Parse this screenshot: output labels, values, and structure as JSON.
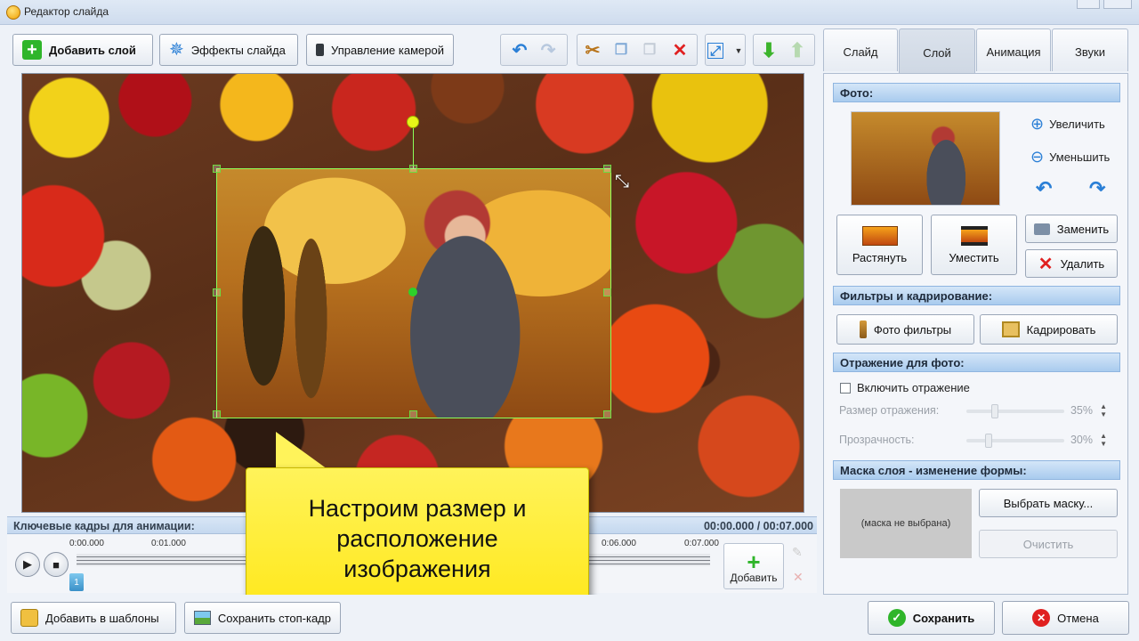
{
  "window": {
    "title": "Редактор слайда"
  },
  "toolbar": {
    "add_layer": "Добавить слой",
    "slide_effects": "Эффекты слайда",
    "camera": "Управление камерой",
    "icons": [
      "undo-icon",
      "redo-icon",
      "cut-icon",
      "copy-icon",
      "paste-icon",
      "delete-icon",
      "fit-view-icon",
      "move-down-icon",
      "move-up-icon"
    ]
  },
  "callout": {
    "text": "Настроим размер и\nрасположение\nизображения"
  },
  "keyframes": {
    "label": "Ключевые кадры для анимации:",
    "time": "00:00.000 / 00:07.000",
    "ticks": [
      "0:00.000",
      "0:01.000",
      "0:06.000",
      "0:07.000"
    ],
    "marker": "1",
    "add_label": "Добавить"
  },
  "tabs": [
    {
      "label": "Слайд",
      "active": false
    },
    {
      "label": "Слой",
      "active": true
    },
    {
      "label": "Анимация",
      "active": false
    },
    {
      "label": "Звуки",
      "active": false
    }
  ],
  "panel": {
    "photo_section": "Фото:",
    "zoom_in": "Увеличить",
    "zoom_out": "Уменьшить",
    "stretch": "Растянуть",
    "fit": "Уместить",
    "replace": "Заменить",
    "delete": "Удалить",
    "filters_section": "Фильтры и кадрирование:",
    "photo_filters": "Фото фильтры",
    "crop": "Кадрировать",
    "reflection_section": "Отражение для фото:",
    "enable_reflection": "Включить отражение",
    "reflection_size_label": "Размер отражения:",
    "reflection_size_value": "35%",
    "transparency_label": "Прозрачность:",
    "transparency_value": "30%",
    "mask_section": "Маска слоя - изменение формы:",
    "mask_preview": "(маска не выбрана)",
    "choose_mask": "Выбрать маску...",
    "clear": "Очистить"
  },
  "bottom": {
    "add_to_templates": "Добавить в шаблоны",
    "save_frame": "Сохранить стоп-кадр",
    "save": "Сохранить",
    "cancel": "Отмена"
  },
  "colors": {
    "accent": "#a9cbee",
    "callout": "#ffe81c",
    "selection": "#8cff5a",
    "add_green": "#2fb52a",
    "delete_red": "#e02020"
  }
}
